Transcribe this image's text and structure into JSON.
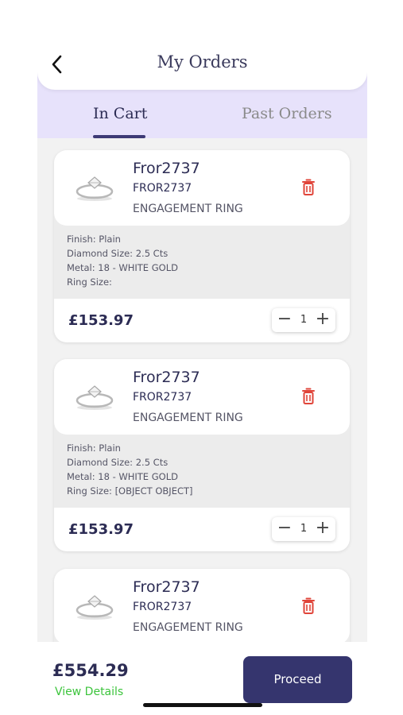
{
  "header": {
    "title": "My Orders",
    "back_icon": "chevron-left-icon"
  },
  "tabs": [
    {
      "label": "In Cart",
      "active": true
    },
    {
      "label": "Past Orders",
      "active": false
    }
  ],
  "colors": {
    "primary": "#35356e",
    "tab_bg": "#e7e2fb",
    "delete": "#e0453a",
    "view_details": "#3cc43c"
  },
  "cart": {
    "items": [
      {
        "name": "Fror2737",
        "code": "FROR2737",
        "type": "ENGAGEMENT RING",
        "details": [
          "Finish:  Plain",
          "Diamond Size: 2.5 Cts",
          "Metal: 18 - WHITE GOLD",
          "Ring Size:"
        ],
        "price": "£153.97",
        "qty": "1",
        "minus": "−",
        "plus": "+"
      },
      {
        "name": "Fror2737",
        "code": "FROR2737",
        "type": "ENGAGEMENT RING",
        "details": [
          "Finish:  Plain",
          "Diamond Size: 2.5 Cts",
          "Metal: 18 - WHITE GOLD",
          "Ring Size: [OBJECT OBJECT]"
        ],
        "price": "£153.97",
        "qty": "1",
        "minus": "−",
        "plus": "+"
      },
      {
        "name": "Fror2737",
        "code": "FROR2737",
        "type": "ENGAGEMENT RING"
      }
    ]
  },
  "footer": {
    "total": "£554.29",
    "view_details": "View Details",
    "proceed": "Proceed"
  }
}
